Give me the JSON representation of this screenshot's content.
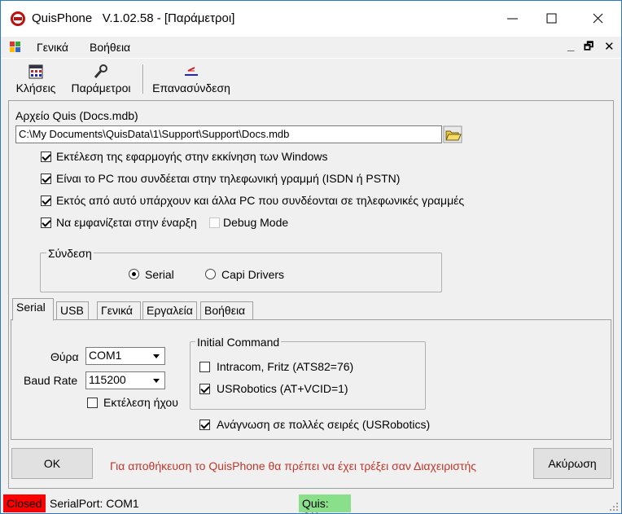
{
  "window": {
    "title": "QuisPhone   V.1.02.58 - [Παράμετροι]"
  },
  "menu": {
    "items": [
      "Γενικά",
      "Βοήθεια"
    ],
    "mdi_controls": [
      "_",
      "🗗",
      "✕"
    ]
  },
  "toolbar": {
    "calls": "Κλήσεις",
    "params": "Παράμετροι",
    "reconnect": "Επανασύνδεση"
  },
  "form": {
    "quis_file_label": "Αρχείο Quis (Docs.mdb)",
    "quis_file_path": "C:\\My Documents\\QuisData\\1\\Support\\Support\\Docs.mdb",
    "checkboxes": [
      {
        "label": "Εκτέλεση της εφαρμογής στην εκκίνηση των Windows",
        "checked": true
      },
      {
        "label": "Είναι το PC που συνδέεται στην τηλεφωνική γραμμή (ISDN ή PSTN)",
        "checked": true
      },
      {
        "label": "Εκτός από αυτό υπάρχουν και άλλα PC που συνδέονται σε τηλεφωνικές γραμμές",
        "checked": true
      },
      {
        "label": "Να εμφανίζεται στην έναρξη",
        "checked": true
      }
    ],
    "debug_mode": {
      "label": "Debug Mode",
      "checked": false
    },
    "connection": {
      "label": "Σύνδεση",
      "serial": "Serial",
      "capi": "Capi Drivers",
      "selected": "Serial"
    },
    "tabs": [
      "Serial",
      "USB",
      "Γενικά",
      "Εργαλεία",
      "Βοήθεια"
    ],
    "serial_tab": {
      "port_label": "Θύρα",
      "port_value": "COM1",
      "baud_label": "Baud Rate",
      "baud_value": "115200",
      "sound_label": "Εκτέλεση ήχου",
      "sound_checked": false,
      "initial_command_label": "Initial Command",
      "intracom_label": "Intracom, Fritz (ATS82=76)",
      "intracom_checked": false,
      "usrobotics_label": "USRobotics (AT+VCID=1)",
      "usrobotics_checked": true,
      "multiline_label": "Ανάγνωση σε πολλές σειρές (USRobotics)",
      "multiline_checked": true
    },
    "ok_label": "OK",
    "cancel_label": "Ακύρωση",
    "warning": "Για αποθήκευση το QuisPhone θα πρέπει να έχει τρέξει σαν Διαχειριστής"
  },
  "status": {
    "state": "Closed",
    "port": "SerialPort: COM1",
    "quis": "Quis: OK"
  },
  "colors": {
    "closed_bg": "#ff0000",
    "quis_ok_bg": "#8ae08a",
    "warning_text": "#c0362c"
  }
}
